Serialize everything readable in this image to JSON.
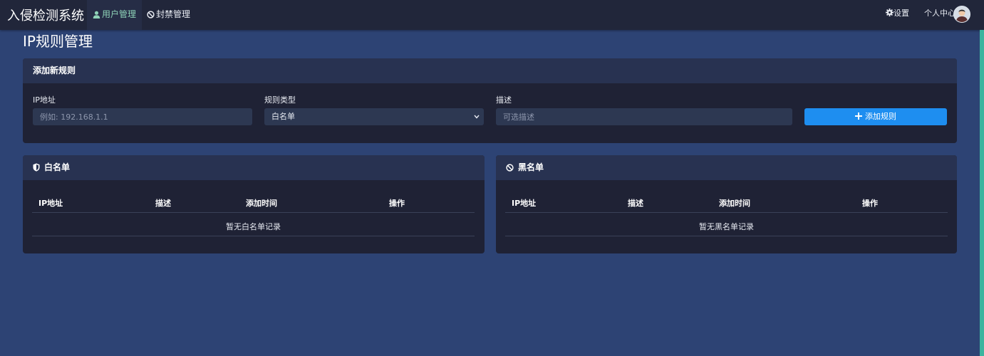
{
  "app": {
    "title": "入侵检测系统"
  },
  "nav": {
    "user_mgmt": "用户管理",
    "ban_mgmt": "封禁管理",
    "settings": "设置",
    "profile": "个人中心"
  },
  "page": {
    "title": "IP规则管理"
  },
  "add_rule": {
    "header": "添加新规则",
    "ip_label": "IP地址",
    "ip_placeholder": "例如: 192.168.1.1",
    "type_label": "规则类型",
    "type_value": "白名单",
    "desc_label": "描述",
    "desc_placeholder": "可选描述",
    "button": "添加规则"
  },
  "whitelist": {
    "header": "白名单",
    "columns": [
      "IP地址",
      "描述",
      "添加时间",
      "操作"
    ],
    "empty": "暂无白名单记录"
  },
  "blacklist": {
    "header": "黑名单",
    "columns": [
      "IP地址",
      "描述",
      "添加时间",
      "操作"
    ],
    "empty": "暂无黑名单记录"
  },
  "colors": {
    "page_bg": "#2d4374",
    "navbar_bg": "#21263a",
    "card_bg": "#1f2235",
    "card_header_bg": "#283251",
    "primary": "#1e8ef0",
    "active_nav": "#8fd3b8"
  },
  "icons": {
    "user": "user-icon",
    "ban": "ban-icon",
    "settings": "gear-icon",
    "plus": "plus-icon",
    "whitelist": "shield-icon",
    "blacklist": "ban-icon"
  }
}
